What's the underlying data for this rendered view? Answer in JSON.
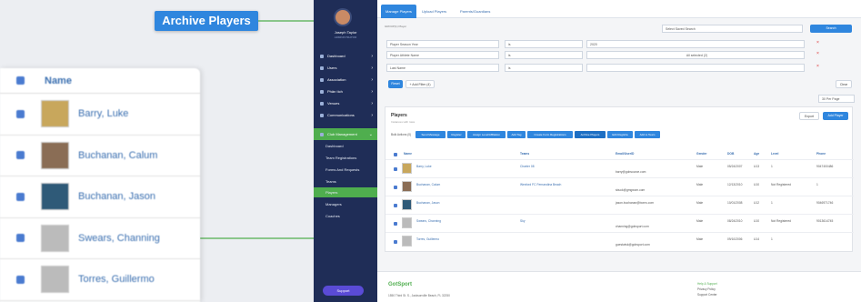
{
  "callout": {
    "label": "Archive Players"
  },
  "colors": {
    "accent": "#2f86de",
    "sidebar": "#1f2d57",
    "active_nav": "#4fae4e",
    "connector": "#4fae4e"
  },
  "zoom": {
    "header_label": "Name",
    "rows": [
      {
        "name": "Barry, Luke"
      },
      {
        "name": "Buchanan, Calum"
      },
      {
        "name": "Buchanan, Jason"
      },
      {
        "name": "Swears, Channing"
      },
      {
        "name": "Torres, Guillermo"
      }
    ]
  },
  "sidebar": {
    "user_name": "Joseph Taylor",
    "user_sub": "ADMINISTRATOR",
    "items": [
      {
        "label": "Dashboard"
      },
      {
        "label": "Users"
      },
      {
        "label": "Association"
      },
      {
        "label": "Phân tích"
      },
      {
        "label": "Venues"
      },
      {
        "label": "Communications"
      },
      {
        "label": "Club Management"
      }
    ],
    "subitems": [
      {
        "label": "Dashboard"
      },
      {
        "label": "Team Registrations"
      },
      {
        "label": "Forms And Requests"
      },
      {
        "label": "Teams"
      },
      {
        "label": "Players"
      },
      {
        "label": "Managers"
      },
      {
        "label": "Coaches"
      }
    ],
    "support_label": "Support"
  },
  "tabs": [
    {
      "label": "Manage Players"
    },
    {
      "label": "Upload Players"
    },
    {
      "label": "Parents/Guardians"
    }
  ],
  "search": {
    "placeholder": "Select Saved Search",
    "button": "Search"
  },
  "crumbs": "GROUP(1)    Player",
  "filters": [
    {
      "field": "Player Season Year",
      "op": "is",
      "value": "2020"
    },
    {
      "field": "Player Athlete Name",
      "op": "is",
      "value": "All selected (2)"
    },
    {
      "field": "Last Name",
      "op": "is",
      "value": ""
    }
  ],
  "filter_buttons": {
    "reset": "Reset",
    "add": "+ Add Filter (4)",
    "clear": "Clear"
  },
  "per_page": "30 Per Page",
  "panel": {
    "title": "Players",
    "subtitle": "Instances with rows",
    "export": "Export",
    "add": "Add Player",
    "bulk_label": "Bulk Actions (0)",
    "bulk_actions": [
      "Send Message",
      "Register",
      "Assign Level/Affiliation",
      "Add Tag",
      "Create Form Registrations",
      "Archive Players",
      "Edit Registra",
      "Add to Team"
    ],
    "columns": [
      "Name",
      "Teams",
      "Email/UserID",
      "Gender",
      "DOB",
      "Age",
      "Level",
      "Phone"
    ],
    "rows": [
      {
        "name": "Barry, Luke",
        "team": "Charter 08",
        "email": "barry@gobsource.com",
        "gender": "Male",
        "dob": "05/24/2007",
        "age": "U13",
        "level": "1",
        "phone": "9047400486"
      },
      {
        "name": "Buchanan, Calum",
        "team": "Wexford FC Fernandina Beach",
        "email": "sbuck@gmgwcm.com",
        "gender": "Male",
        "dob": "12/13/2010",
        "age": "U10",
        "level": "Not Registered",
        "phone": "1"
      },
      {
        "name": "Buchanan, Jason",
        "team": "",
        "email": "jason.buchanan@borns.com",
        "gender": "Male",
        "dob": "10/01/2008",
        "age": "U12",
        "level": "1",
        "phone": "9046971746"
      },
      {
        "name": "Swears, Channing",
        "team": "Sky",
        "email": "channing@gobsport.com",
        "gender": "Male",
        "dob": "08/24/2010",
        "age": "U10",
        "level": "Not Registered",
        "phone": "9013614745"
      },
      {
        "name": "Torres, Guillermo",
        "team": "",
        "email": "guestwisk@gobsport.com",
        "gender": "Male",
        "dob": "09/10/2006",
        "age": "U14",
        "level": "1",
        "phone": ""
      }
    ]
  },
  "footer": {
    "logo": "GotSport",
    "address": "1550 Third St. S., Jacksonville Beach, FL 32250",
    "links": [
      "Help & Support",
      "Privacy Policy",
      "Support Center"
    ]
  }
}
